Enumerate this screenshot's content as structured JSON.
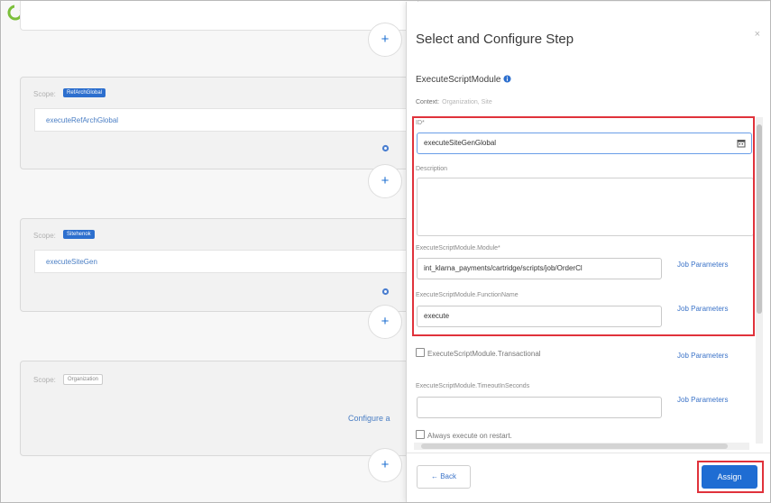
{
  "canvas": {
    "cards": [
      {
        "scope_label": "Scope:",
        "scope_value": "RefArchGlobal",
        "step_id": "executeRefArchGlobal"
      },
      {
        "scope_label": "Scope:",
        "scope_value": "Sitehenok",
        "step_id": "executeSiteGen"
      },
      {
        "scope_label": "Scope:",
        "scope_value": "Organization",
        "configure_link": "Configure a"
      }
    ],
    "add_symbol": "+"
  },
  "panel": {
    "title": "Select and Configure Step",
    "close_symbol": "×",
    "step_name": "ExecuteScriptModule",
    "context_label": "Context:",
    "context_value": "Organization, Site",
    "fields": {
      "id_label": "ID*",
      "id_value": "executeSiteGenGlobal",
      "description_label": "Description",
      "module_label": "ExecuteScriptModule.Module*",
      "module_value": "int_klarna_payments/cartridge/scripts/job/OrderCl",
      "function_label": "ExecuteScriptModule.FunctionName",
      "function_value": "execute",
      "transactional_label": "ExecuteScriptModule.Transactional",
      "timeout_label": "ExecuteScriptModule.TimeoutInSeconds",
      "restart_label": "Always execute on restart."
    },
    "job_parameters_label": "Job Parameters",
    "back_label": "Back",
    "back_arrow": "←",
    "assign_label": "Assign"
  },
  "colors": {
    "accent": "#1f6dd3",
    "highlight": "#e0323b",
    "link": "#3b73c8"
  }
}
